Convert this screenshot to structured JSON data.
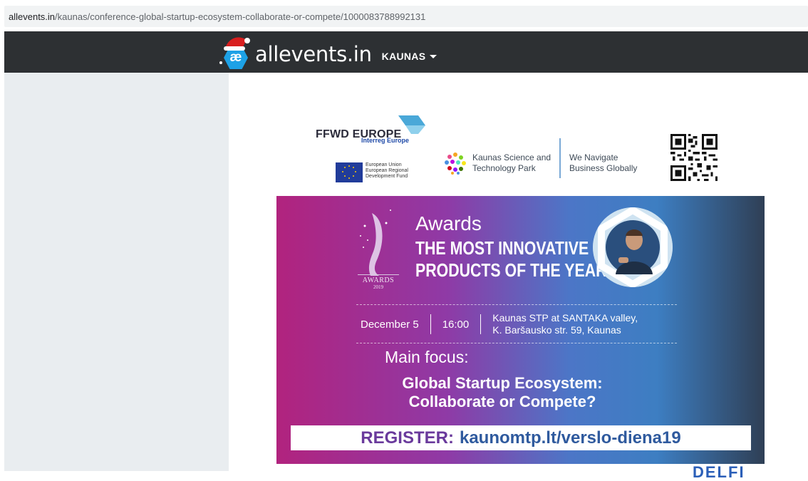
{
  "browser": {
    "url_domain": "allevents.in",
    "url_path": "/kaunas/conference-global-startup-ecosystem-collaborate-or-compete/1000083788992131"
  },
  "topnav": {
    "logo_glyph": "æ",
    "logo_text": "allevents.in",
    "city": "KAUNAS",
    "bg_color": "#2d3033",
    "accent_color": "#1da1e6"
  },
  "sponsors": {
    "ffwd_title": "FFWD EUROPE",
    "interreg": "Interreg Europe",
    "eu_lines": [
      "European Union",
      "European Regional",
      "Development Fund"
    ],
    "ksp_lines": [
      "Kaunas Science and",
      "Technology Park"
    ],
    "navigate_lines": [
      "We Navigate",
      "Business Globally"
    ]
  },
  "banner": {
    "awards_word": "Awards",
    "headline_lines": [
      "THE MOST INNOVATIVE",
      "PRODUCTS OF THE YEAR"
    ],
    "awards_badge": "AWARDS",
    "awards_year": "2019",
    "date": "December 5",
    "time": "16:00",
    "venue_lines": [
      "Kaunas STP at SANTAKA valley,",
      "K. Baršausko str. 59, Kaunas"
    ],
    "focus_label": "Main focus:",
    "topic_lines": [
      "Global Startup Ecosystem:",
      "Collaborate or Compete?"
    ],
    "register_label": "REGISTER:",
    "register_url": "kaunomtp.lt/verslo-diena19"
  },
  "footer_partial": {
    "logo_text": "DELFI"
  }
}
